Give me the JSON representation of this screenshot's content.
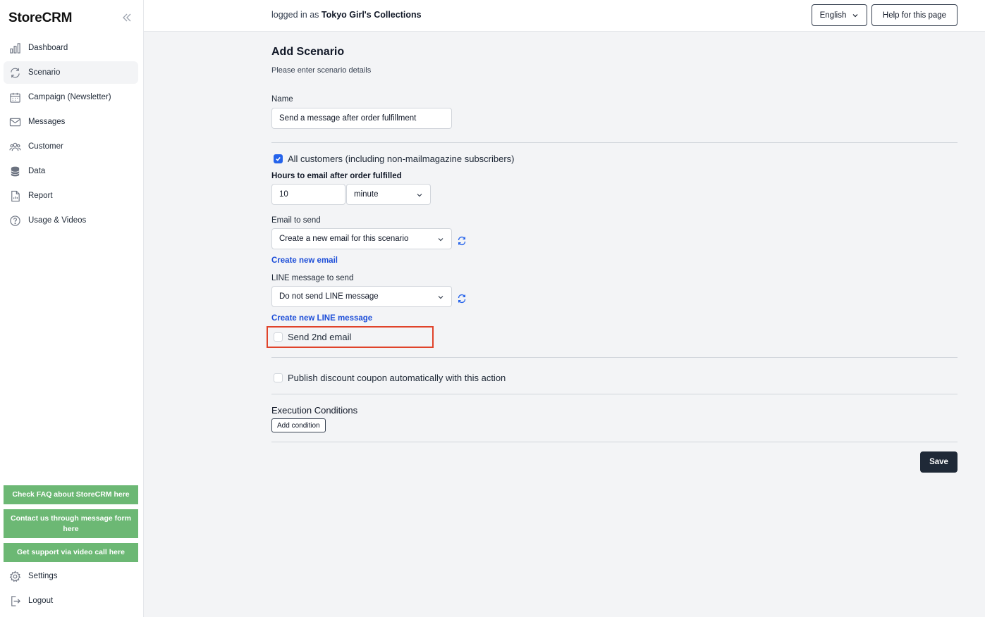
{
  "sidebar": {
    "logo": "StoreCRM",
    "items": [
      {
        "label": "Dashboard",
        "icon": "bar-chart-icon"
      },
      {
        "label": "Scenario",
        "icon": "refresh-cycle-icon",
        "active": true
      },
      {
        "label": "Campaign (Newsletter)",
        "icon": "calendar-icon"
      },
      {
        "label": "Messages",
        "icon": "envelope-icon"
      },
      {
        "label": "Customer",
        "icon": "users-icon"
      },
      {
        "label": "Data",
        "icon": "database-icon"
      },
      {
        "label": "Report",
        "icon": "document-icon"
      },
      {
        "label": "Usage & Videos",
        "icon": "question-circle-icon"
      }
    ],
    "support": {
      "faq": "Check FAQ about StoreCRM here",
      "contact": "Contact us through message form here",
      "video": "Get support via video call here"
    },
    "settings_label": "Settings",
    "logout_label": "Logout"
  },
  "header": {
    "logged_in_prefix": "logged in as",
    "store_name": "Tokyo Girl's Collections",
    "language": "English",
    "help_label": "Help for this page"
  },
  "form": {
    "title": "Add Scenario",
    "subtitle": "Please enter scenario details",
    "name_label": "Name",
    "name_value": "Send a message after order fulfillment",
    "all_customers_label": "All customers (including non-mailmagazine subscribers)",
    "all_customers_checked": true,
    "hours_label": "Hours to email after order fulfilled",
    "hours_value": "10",
    "hours_unit": "minute",
    "email_label": "Email to send",
    "email_value": "Create a new email for this scenario",
    "create_email_link": "Create new email",
    "line_label": "LINE message to send",
    "line_value": "Do not send LINE message",
    "create_line_link": "Create new LINE message",
    "second_email_label": "Send 2nd email",
    "second_email_checked": false,
    "coupon_label": "Publish discount coupon automatically with this action",
    "coupon_checked": false,
    "execution_title": "Execution Conditions",
    "add_condition_label": "Add condition",
    "save_label": "Save"
  },
  "colors": {
    "support_green": "#6cb874",
    "highlight_red": "#e0432a",
    "link_blue": "#1d4ed8",
    "save_dark": "#1f2937"
  }
}
